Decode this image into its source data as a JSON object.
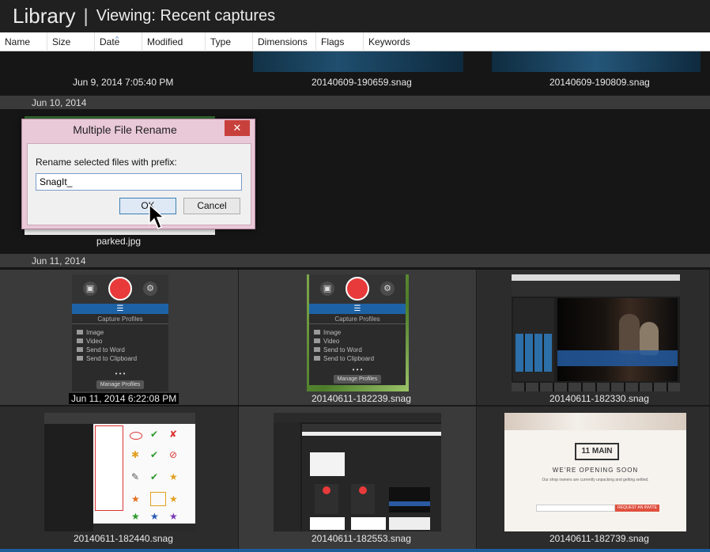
{
  "header": {
    "title": "Library",
    "separator": "|",
    "subtitle": "Viewing: Recent captures"
  },
  "columns": [
    "Name",
    "Size",
    "Date",
    "Modified",
    "Type",
    "Dimensions",
    "Flags",
    "Keywords"
  ],
  "sort_indicator": "^",
  "top_row": {
    "captions": [
      "Jun 9, 2014 7:05:40 PM",
      "20140609-190659.snag",
      "20140609-190809.snag"
    ]
  },
  "groups": [
    {
      "label": "Jun 10, 2014"
    },
    {
      "label": "Jun 11, 2014"
    }
  ],
  "jun10": {
    "caption": "parked.jpg"
  },
  "grid": {
    "row1": [
      "Jun 11, 2014 6:22:08 PM",
      "20140611-182239.snag",
      "20140611-182330.snag"
    ],
    "row2": [
      "20140611-182440.snag",
      "20140611-182553.snag",
      "20140611-182739.snag"
    ]
  },
  "widget": {
    "menu_label": "☰",
    "profiles_title": "Capture Profiles",
    "items": [
      "Image",
      "Video",
      "Send to Word",
      "Send to Clipboard"
    ],
    "dots": "• • •",
    "manage_label": "Manage Profiles"
  },
  "web_thumb": {
    "brand": "11 MAIN",
    "headline": "WE'RE OPENING SOON",
    "sub": "Our shop owners are currently unpacking and getting settled.",
    "cta": "REQUEST AN INVITE"
  },
  "dialog": {
    "title": "Multiple File Rename",
    "close_label": "✕",
    "label": "Rename selected files with prefix:",
    "input_value": "SnagIt_",
    "ok_label": "OK",
    "cancel_label": "Cancel"
  },
  "colors": {
    "background": "#161616",
    "cell": "#3a3a3a",
    "accent_blue": "#1e62a6",
    "record_red": "#e83a3a",
    "dialog_frame": "#e9c8d7",
    "close_red": "#c8403b"
  }
}
